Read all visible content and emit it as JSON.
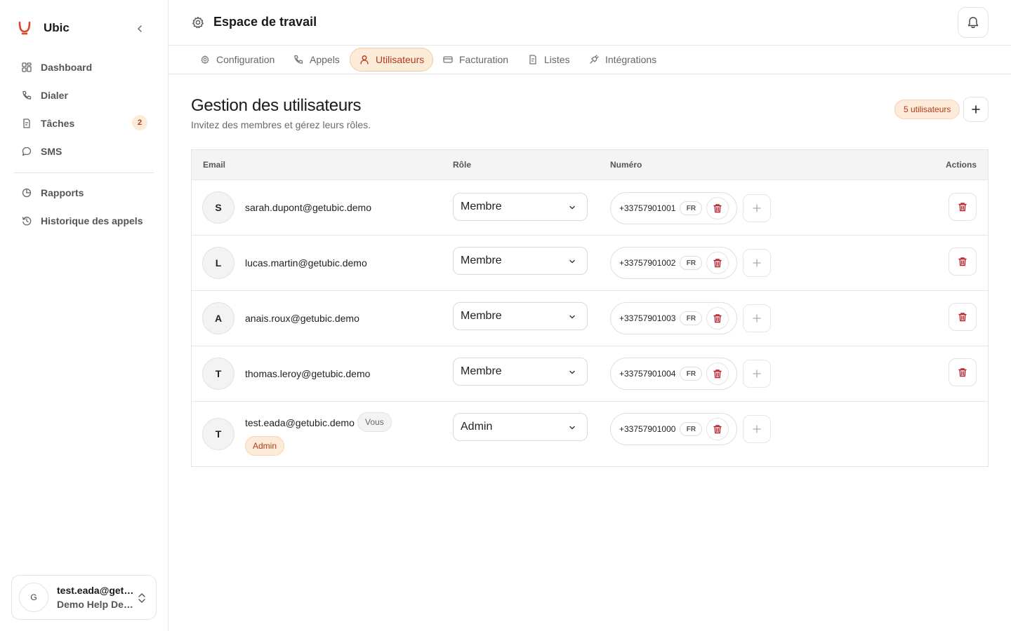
{
  "sidebar": {
    "brand_name": "Ubic",
    "items": [
      {
        "label": "Dashboard",
        "icon": "dashboard-icon"
      },
      {
        "label": "Dialer",
        "icon": "phone-icon"
      },
      {
        "label": "Tâches",
        "icon": "tasks-icon",
        "badge": "2"
      },
      {
        "label": "SMS",
        "icon": "chat-icon"
      },
      {
        "label": "Rapports",
        "icon": "pie-chart-icon"
      },
      {
        "label": "Historique des appels",
        "icon": "history-icon"
      }
    ],
    "user": {
      "initial": "G",
      "email": "test.eada@getubic.demo",
      "org": "Demo Help Desk"
    }
  },
  "header": {
    "title": "Espace de travail"
  },
  "tabs": [
    {
      "label": "Configuration",
      "icon": "gear-icon"
    },
    {
      "label": "Appels",
      "icon": "phone-icon"
    },
    {
      "label": "Utilisateurs",
      "icon": "user-icon",
      "active": true
    },
    {
      "label": "Facturation",
      "icon": "credit-card-icon"
    },
    {
      "label": "Listes",
      "icon": "list-icon"
    },
    {
      "label": "Intégrations",
      "icon": "plug-icon"
    }
  ],
  "main": {
    "title": "Gestion des utilisateurs",
    "subtitle": "Invitez des membres et gérez leurs rôles.",
    "count_badge": "5 utilisateurs",
    "columns": [
      "Email",
      "Rôle",
      "Numéro",
      "Actions"
    ],
    "users": [
      {
        "initial": "S",
        "email": "sarah.dupont@getubic.demo",
        "role": "Membre",
        "phone": "+33757901001",
        "country": "FR"
      },
      {
        "initial": "L",
        "email": "lucas.martin@getubic.demo",
        "role": "Membre",
        "phone": "+33757901002",
        "country": "FR"
      },
      {
        "initial": "A",
        "email": "anais.roux@getubic.demo",
        "role": "Membre",
        "phone": "+33757901003",
        "country": "FR"
      },
      {
        "initial": "T",
        "email": "thomas.leroy@getubic.demo",
        "role": "Membre",
        "phone": "+33757901004",
        "country": "FR"
      },
      {
        "initial": "T",
        "email": "test.eada@getubic.demo",
        "role": "Admin",
        "phone": "+33757901000",
        "country": "FR",
        "you_badge": "Vous",
        "role_badge": "Admin"
      }
    ]
  },
  "colors": {
    "accent": "#e4412b",
    "accent_soft": "#fdebd9",
    "danger": "#b8202a"
  }
}
